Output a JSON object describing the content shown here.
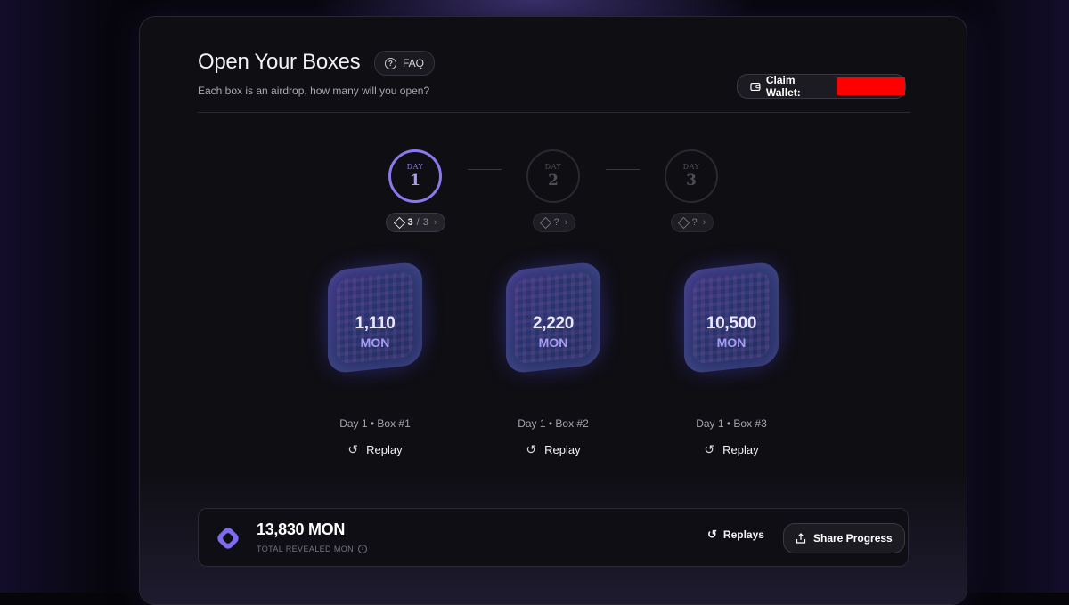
{
  "header": {
    "title": "Open Your Boxes",
    "faq_label": "FAQ",
    "subtitle": "Each box is an airdrop, how many will you open?",
    "wallet_label": "Claim Wallet:"
  },
  "days": [
    {
      "label": "DAY",
      "number": "1",
      "opened": "3",
      "total": "3",
      "active": true
    },
    {
      "label": "DAY",
      "number": "2",
      "opened": "?",
      "active": false
    },
    {
      "label": "DAY",
      "number": "3",
      "opened": "?",
      "active": false
    }
  ],
  "boxes": [
    {
      "value": "1,110",
      "unit": "MON",
      "caption": "Day 1 • Box #1",
      "replay_label": "Replay"
    },
    {
      "value": "2,220",
      "unit": "MON",
      "caption": "Day 1 • Box #2",
      "replay_label": "Replay"
    },
    {
      "value": "10,500",
      "unit": "MON",
      "caption": "Day 1 • Box #3",
      "replay_label": "Replay"
    }
  ],
  "summary": {
    "total": "13,830 MON",
    "total_label": "TOTAL REVEALED MON",
    "replays_label": "Replays",
    "share_label": "Share Progress"
  },
  "colors": {
    "accent": "#8a78ef",
    "redaction": "#ff0000",
    "panel": "#0f0e13"
  }
}
